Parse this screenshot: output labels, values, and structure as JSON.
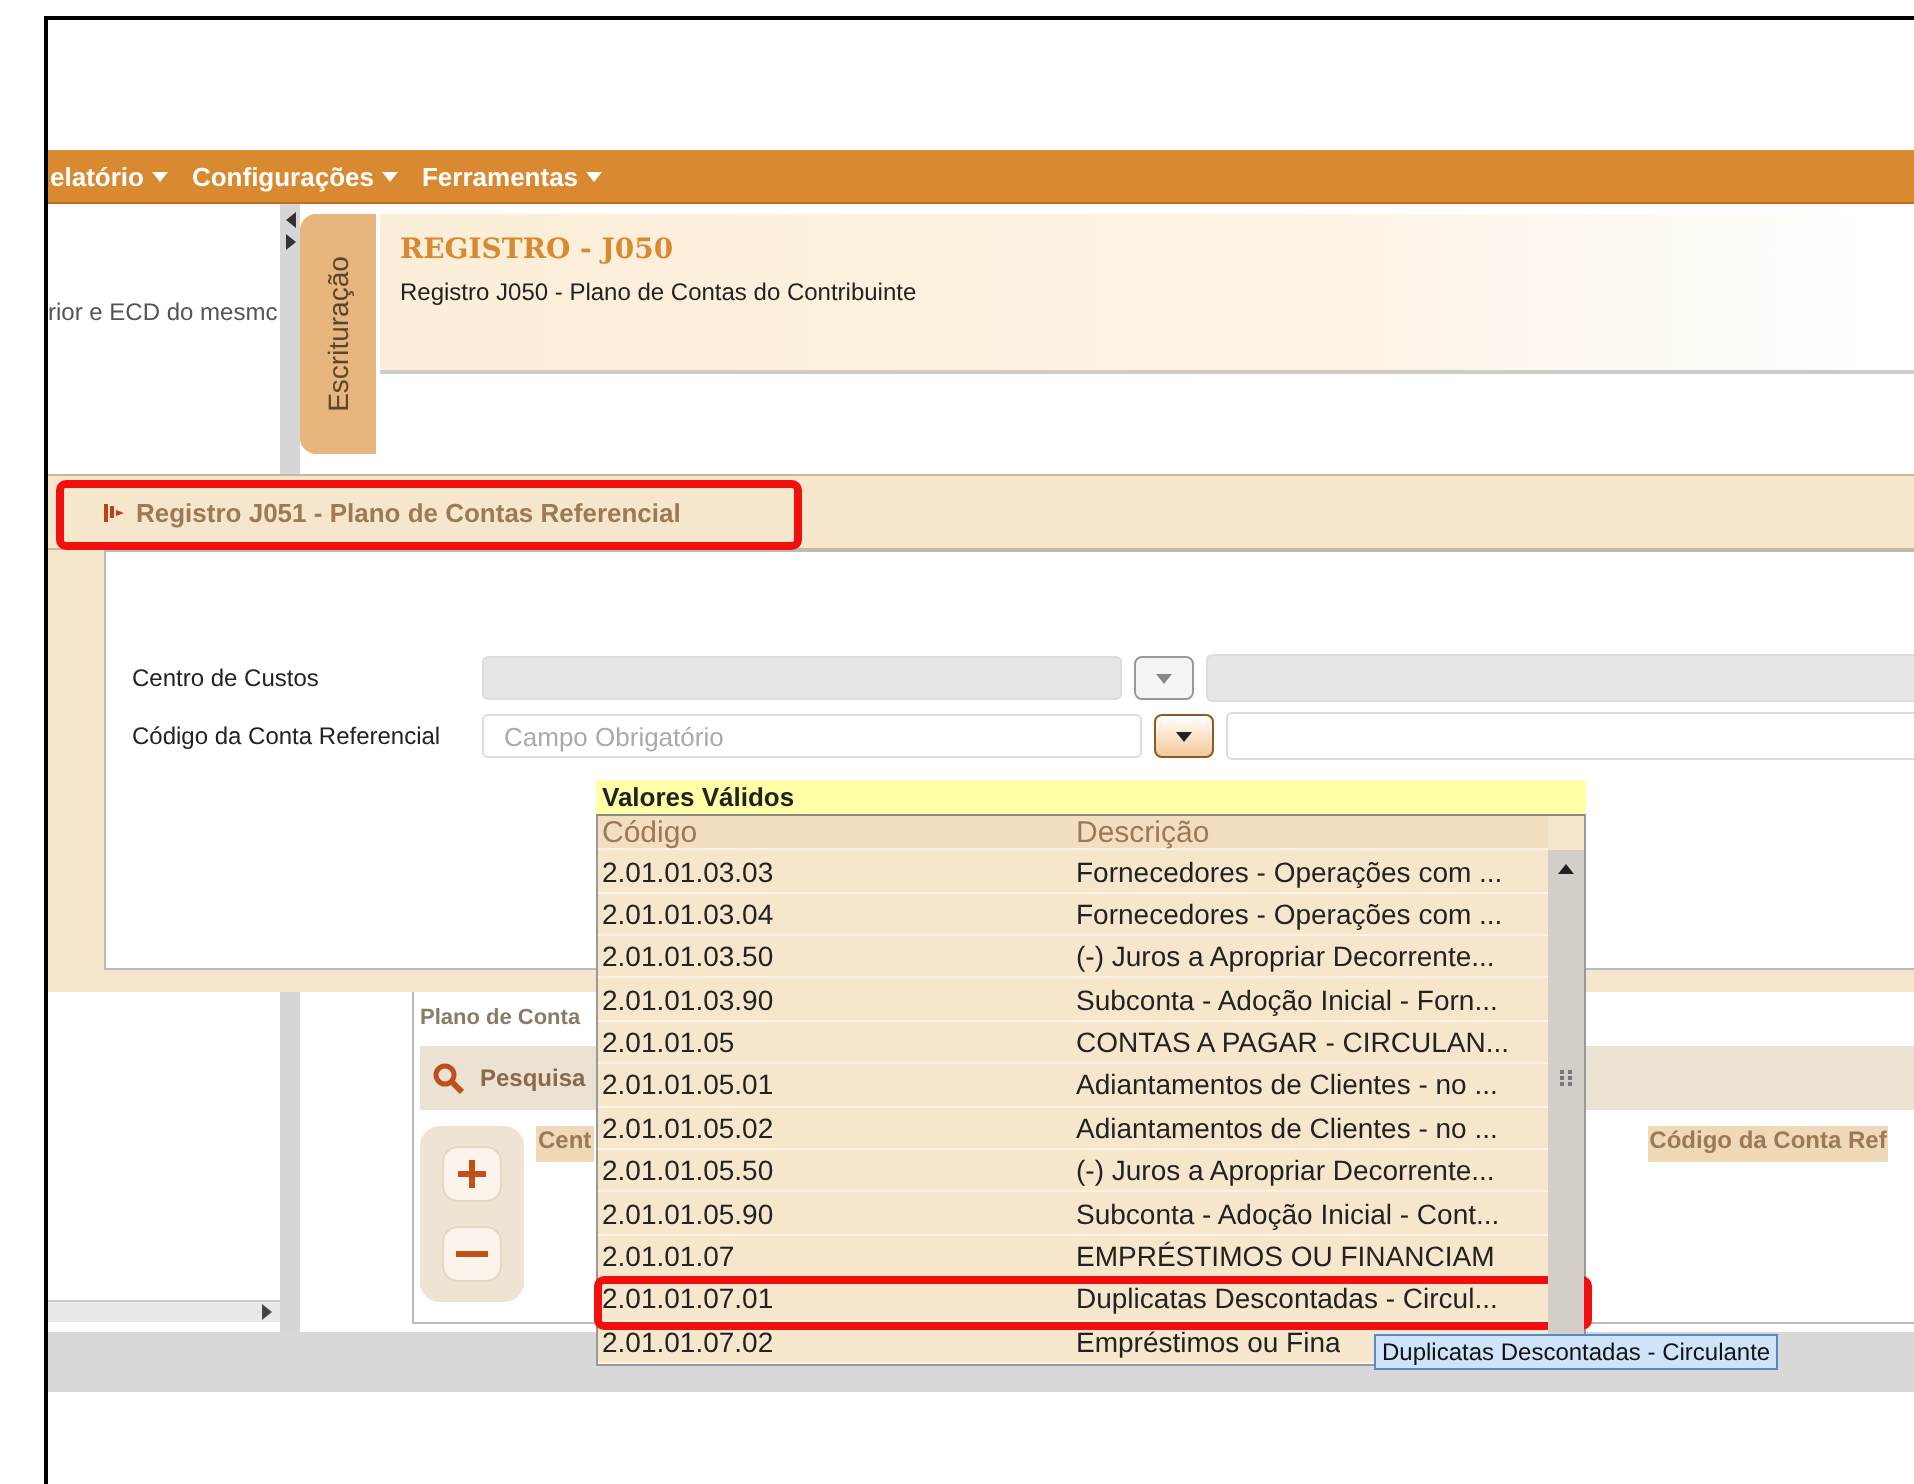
{
  "menu_bar": {
    "items": [
      {
        "label": "elatório"
      },
      {
        "label": "Configurações"
      },
      {
        "label": "Ferramentas"
      }
    ]
  },
  "sidebar": {
    "text": "rior e ECD do mesmc"
  },
  "side_tab": {
    "label": "Escrituração"
  },
  "header": {
    "title": "REGISTRO - J050",
    "subtitle": "Registro J050 - Plano de Contas do Contribuinte"
  },
  "dialog": {
    "title": "Registro J051 - Plano de Contas Referencial",
    "title_annotated": true,
    "fields": [
      {
        "label": "Centro de Custos",
        "disabled": true
      },
      {
        "label": "Código da Conta Referencial",
        "placeholder": "Campo Obrigatório",
        "disabled": false
      }
    ]
  },
  "background_panel": {
    "title": "Plano de Conta",
    "search_label": "Pesquisa",
    "columns": [
      "Cent",
      "Código da Conta Ref"
    ]
  },
  "dropdown": {
    "title": "Valores Válidos",
    "columns": [
      "Código",
      "Descrição"
    ],
    "rows": [
      {
        "code": "2.01.01.03.03",
        "description": "Fornecedores - Operações com ...",
        "annotated": false
      },
      {
        "code": "2.01.01.03.04",
        "description": "Fornecedores - Operações com ...",
        "annotated": false
      },
      {
        "code": "2.01.01.03.50",
        "description": "(-) Juros a Apropriar Decorrente...",
        "annotated": false
      },
      {
        "code": "2.01.01.03.90",
        "description": "Subconta -  Adoção Inicial -  Forn...",
        "annotated": false
      },
      {
        "code": "2.01.01.05",
        "description": "CONTAS A PAGAR -  CIRCULAN...",
        "annotated": false
      },
      {
        "code": "2.01.01.05.01",
        "description": "Adiantamentos de Clientes - no ...",
        "annotated": false
      },
      {
        "code": "2.01.01.05.02",
        "description": "Adiantamentos de Clientes - no ...",
        "annotated": false
      },
      {
        "code": "2.01.01.05.50",
        "description": "(-) Juros a Apropriar Decorrente...",
        "annotated": false
      },
      {
        "code": "2.01.01.05.90",
        "description": "Subconta -  Adoção Inicial -  Cont...",
        "annotated": false
      },
      {
        "code": "2.01.01.07",
        "description": "EMPRÉSTIMOS OU FINANCIAM",
        "annotated": false
      },
      {
        "code": "2.01.01.07.01",
        "description": "Duplicatas Descontadas - Circul...",
        "annotated": true
      },
      {
        "code": "2.01.01.07.02",
        "description": "Empréstimos ou Fina",
        "annotated": false
      }
    ]
  },
  "tooltip": {
    "text": "Duplicatas Descontadas - Circulante"
  }
}
